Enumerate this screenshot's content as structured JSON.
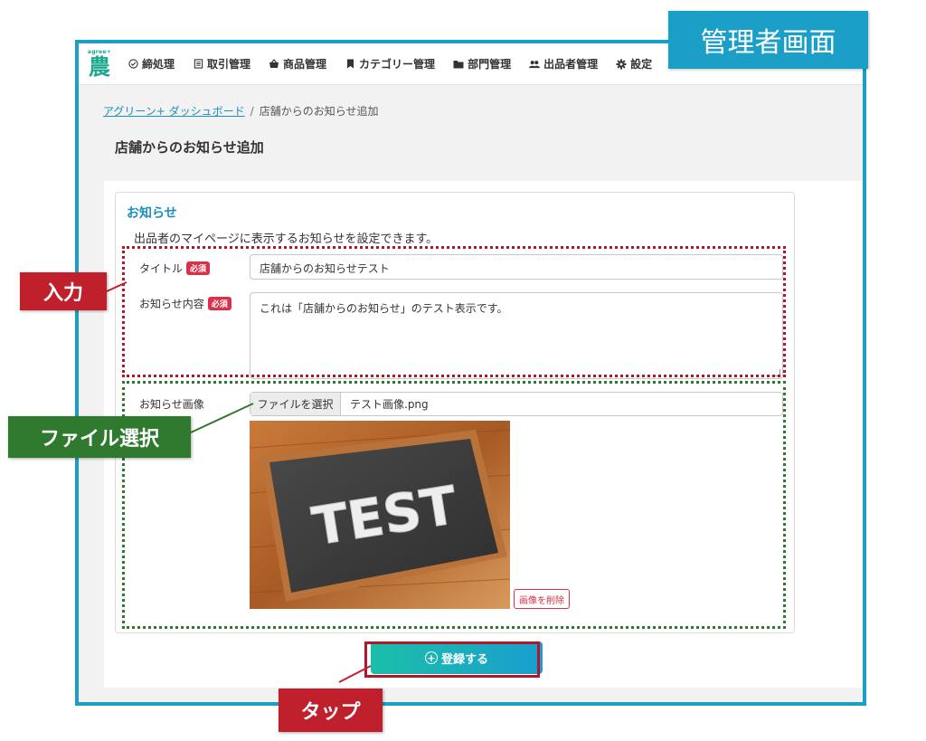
{
  "annotations": {
    "admin_screen": "管理者画面",
    "input": "入力",
    "file_select": "ファイル選択",
    "tap": "タップ"
  },
  "logo": {
    "top": "agree+",
    "char": "農"
  },
  "nav": [
    {
      "label": "締処理",
      "icon": "check-circle-icon"
    },
    {
      "label": "取引管理",
      "icon": "document-icon"
    },
    {
      "label": "商品管理",
      "icon": "basket-icon"
    },
    {
      "label": "カテゴリー管理",
      "icon": "bookmark-icon"
    },
    {
      "label": "部門管理",
      "icon": "folder-icon"
    },
    {
      "label": "出品者管理",
      "icon": "users-icon"
    },
    {
      "label": "設定",
      "icon": "gear-icon"
    }
  ],
  "breadcrumb": {
    "home": "アグリーン+ ダッシュボード",
    "separator": "/",
    "current": "店舗からのお知らせ追加"
  },
  "page_title": "店舗からのお知らせ追加",
  "card": {
    "title": "お知らせ",
    "description": "出品者のマイページに表示するお知らせを設定できます。",
    "required_badge": "必須",
    "title_label": "タイトル",
    "title_value": "店舗からのお知らせテスト",
    "content_label": "お知らせ内容",
    "content_value": "これは「店舗からのお知らせ」のテスト表示です。",
    "image_label": "お知らせ画像",
    "file_button": "ファイルを選択",
    "file_name": "テスト画像.png",
    "image_text": "TEST",
    "delete_image": "画像を削除"
  },
  "submit_label": "登録する",
  "colors": {
    "accent": "#1b9fc6",
    "required": "#d9314b",
    "input_annotation": "#c0202c",
    "file_annotation": "#2f7a2f"
  }
}
